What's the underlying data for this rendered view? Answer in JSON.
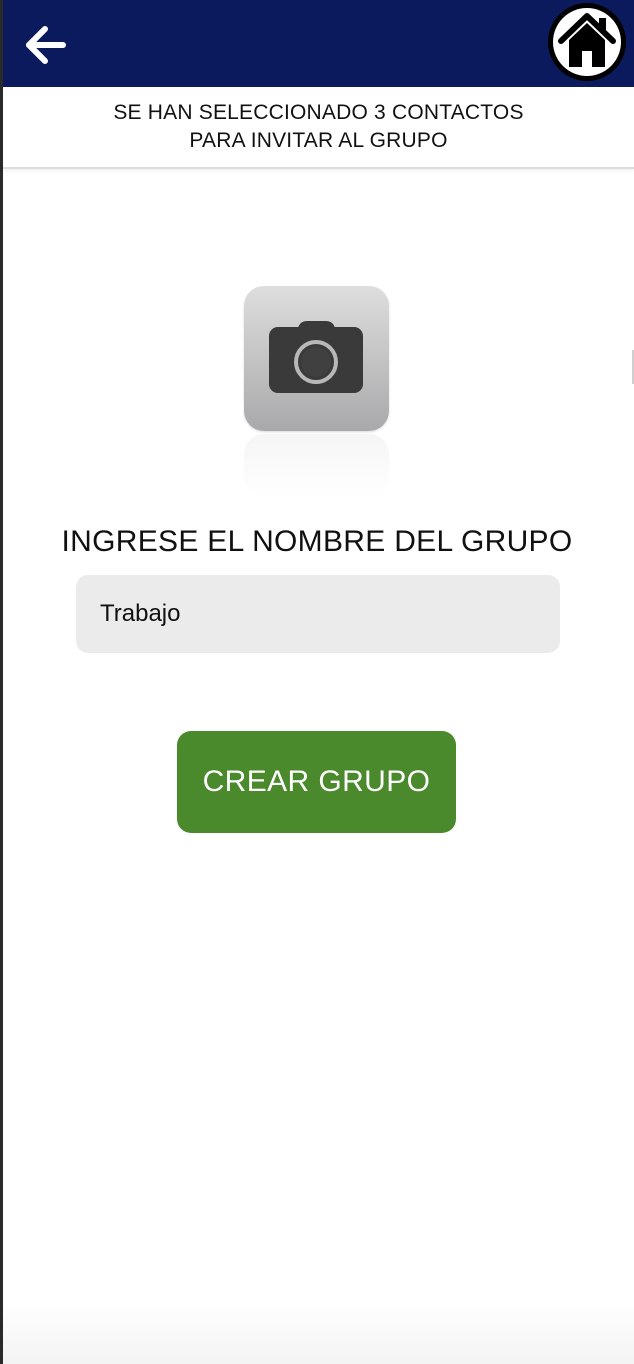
{
  "header": {
    "back_icon": "arrow-left-icon",
    "home_icon": "home-icon",
    "background_color": "#0b1a5c"
  },
  "selection_notice": {
    "text": "SE HAN SELECCIONADO 3 CONTACTOS\nPARA INVITAR AL GRUPO"
  },
  "photo_picker": {
    "icon": "camera-icon"
  },
  "group_form": {
    "label": "INGRESE EL NOMBRE DEL GRUPO",
    "name_value": "Trabajo",
    "submit_label": "CREAR GRUPO",
    "submit_color": "#4a8a2c"
  }
}
